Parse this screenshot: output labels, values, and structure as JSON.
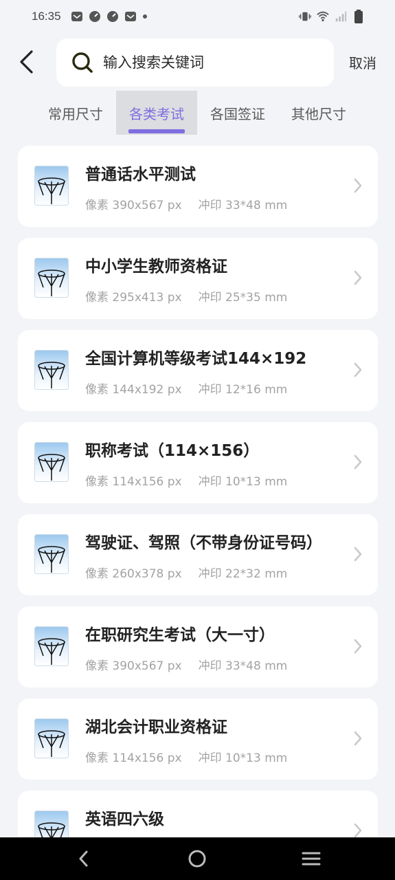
{
  "status_bar": {
    "time": "16:35",
    "left_icons": [
      "mail-icon",
      "clock-icon",
      "clock-icon",
      "mail-icon",
      "dot-icon"
    ],
    "right_icons": [
      "vibrate-icon",
      "wifi-icon",
      "signal-icon",
      "battery-icon"
    ]
  },
  "header": {
    "search_placeholder": "输入搜索关键词",
    "cancel_label": "取消"
  },
  "tabs": [
    {
      "label": "常用尺寸",
      "active": false
    },
    {
      "label": "各类考试",
      "active": true
    },
    {
      "label": "各国签证",
      "active": false
    },
    {
      "label": "其他尺寸",
      "active": false
    }
  ],
  "colors": {
    "accent": "#7e6ee0",
    "background": "#f3f4f7",
    "card": "#ffffff"
  },
  "items": [
    {
      "title": "普通话水平测试",
      "pixels": "像素 390x567 px",
      "print": "冲印 33*48 mm"
    },
    {
      "title": "中小学生教师资格证",
      "pixels": "像素 295x413 px",
      "print": "冲印 25*35 mm"
    },
    {
      "title": "全国计算机等级考试144×192",
      "pixels": "像素 144x192 px",
      "print": "冲印 12*16 mm"
    },
    {
      "title": "职称考试（114×156）",
      "pixels": "像素 114x156 px",
      "print": "冲印 10*13 mm"
    },
    {
      "title": "驾驶证、驾照（不带身份证号码）",
      "pixels": "像素 260x378 px",
      "print": "冲印 22*32 mm"
    },
    {
      "title": "在职研究生考试（大一寸）",
      "pixels": "像素 390x567 px",
      "print": "冲印 33*48 mm"
    },
    {
      "title": "湖北会计职业资格证",
      "pixels": "像素 114x156 px",
      "print": "冲印 10*13 mm"
    },
    {
      "title": "英语四六级",
      "pixels": "",
      "print": ""
    }
  ]
}
